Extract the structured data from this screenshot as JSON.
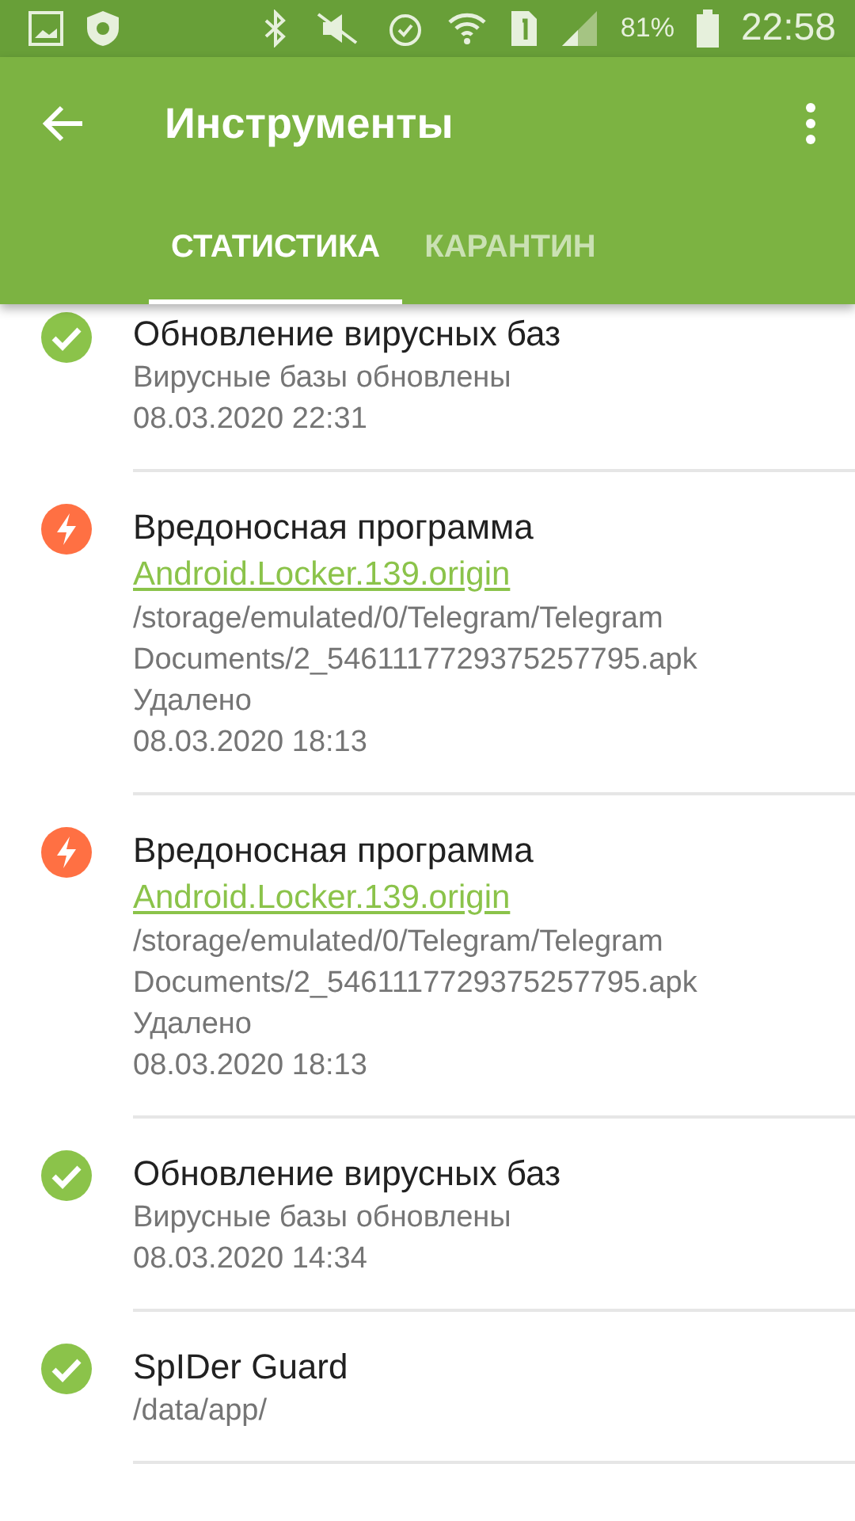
{
  "status_bar": {
    "battery": "81%",
    "time": "22:58"
  },
  "toolbar": {
    "title": "Инструменты"
  },
  "tabs": [
    {
      "label": "СТАТИСТИКА",
      "selected": true
    },
    {
      "label": "КАРАНТИН",
      "selected": false
    }
  ],
  "events": [
    {
      "kind": "ok",
      "title": "Обновление вирусных баз",
      "details": [
        "Вирусные базы обновлены",
        "08.03.2020 22:31"
      ]
    },
    {
      "kind": "threat",
      "title": "Вредоносная программа",
      "link": "Android.Locker.139.origin",
      "details": [
        "/storage/emulated/0/Telegram/Telegram Documents/2_5461117729375257795.apk",
        "Удалено",
        "08.03.2020 18:13"
      ]
    },
    {
      "kind": "threat",
      "title": "Вредоносная программа",
      "link": "Android.Locker.139.origin",
      "details": [
        "/storage/emulated/0/Telegram/Telegram Documents/2_5461117729375257795.apk",
        "Удалено",
        "08.03.2020 18:13"
      ]
    },
    {
      "kind": "ok",
      "title": "Обновление вирусных баз",
      "details": [
        "Вирусные базы обновлены",
        "08.03.2020 14:34"
      ]
    },
    {
      "kind": "ok",
      "title": "SpIDer Guard",
      "details": [
        "/data/app/"
      ]
    }
  ]
}
